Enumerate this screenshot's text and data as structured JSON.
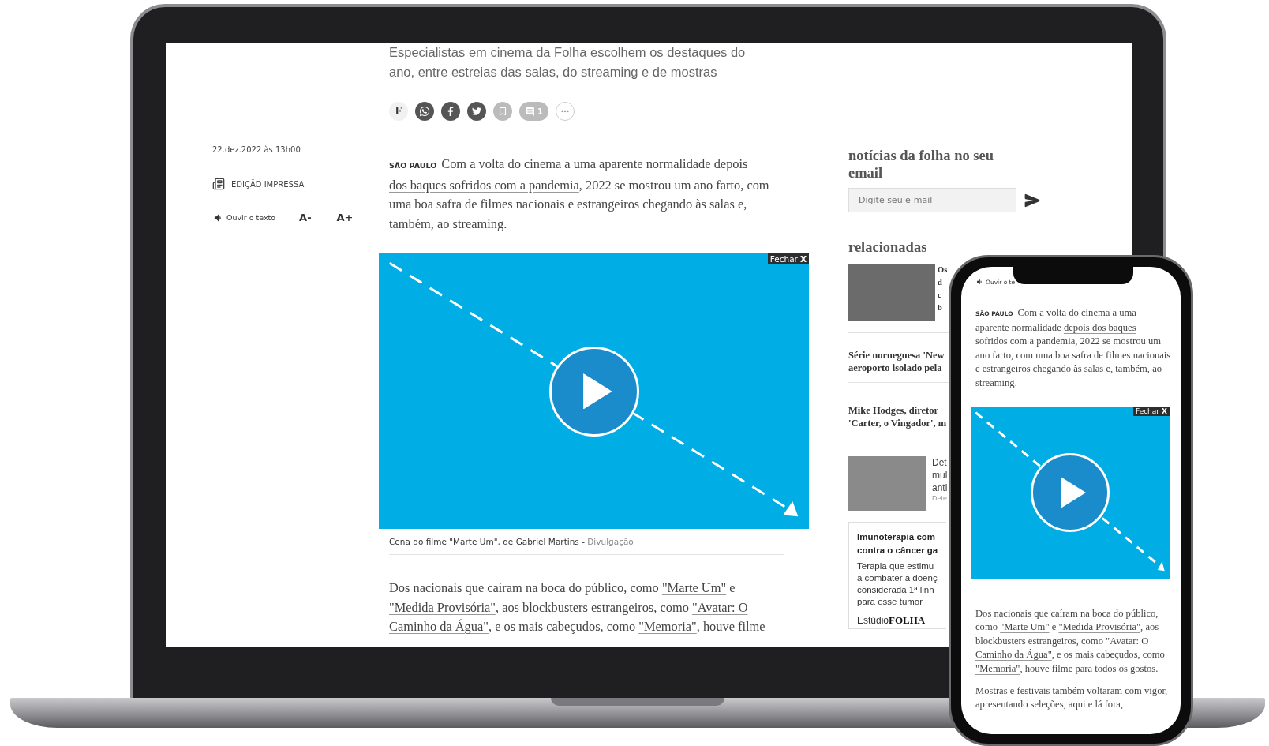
{
  "laptop": {
    "article": {
      "subtitle": "Especialistas em cinema da Folha escolhem os destaques do ano, entre estreias das salas, do streaming e de mostras",
      "share_buttons": [
        {
          "kind": "folha",
          "label": "F"
        },
        {
          "kind": "whatsapp"
        },
        {
          "kind": "facebook"
        },
        {
          "kind": "twitter"
        },
        {
          "kind": "bookmark"
        },
        {
          "kind": "comments",
          "count": "1"
        },
        {
          "kind": "more"
        }
      ],
      "date": "22.dez.2022 às 13h00",
      "print_edition": "EDIÇÃO IMPRESSA",
      "listen": "Ouvir o texto",
      "font_smaller": "A-",
      "font_larger": "A+",
      "lead": {
        "dateline": "SÃO PAULO",
        "segments": [
          {
            "kind": "text",
            "text": "Com a volta do cinema a uma aparente normalidade "
          },
          {
            "kind": "link",
            "text": "depois"
          },
          {
            "kind": "link",
            "text": "dos baques sofridos com a pandemia"
          },
          {
            "kind": "text",
            "text": ", 2022 se mostrou um ano farto, com uma boa safra de filmes nacionais e estrangeiros chegando às salas e, também, ao streaming."
          }
        ]
      },
      "video": {
        "close_label": "Fechar",
        "close_glyph": "X"
      },
      "caption": {
        "text": "Cena do filme \"Marte Um\", de Gabriel Martins -",
        "credit": "Divulgação"
      },
      "paragraphs": [
        {
          "segments": [
            {
              "kind": "text",
              "text": "Dos nacionais que caíram na boca do público, como "
            },
            {
              "kind": "link",
              "text": "\"Marte Um\""
            },
            {
              "kind": "text",
              "text": " e "
            },
            {
              "kind": "link",
              "text": "\"Medida Provisória\""
            },
            {
              "kind": "text",
              "text": ", aos blockbusters estrangeiros, como "
            },
            {
              "kind": "link",
              "text": "\"Avatar: O"
            },
            {
              "kind": "link",
              "text": "Caminho da Água\""
            },
            {
              "kind": "text",
              "text": ", e os mais cabeçudos, como "
            },
            {
              "kind": "link",
              "text": "\"Memoria\""
            },
            {
              "kind": "text",
              "text": ", houve filme"
            }
          ]
        }
      ]
    },
    "sidebar": {
      "newsletter": {
        "title": "notícias da folha no seu email",
        "placeholder": "Digite seu e-mail"
      },
      "related": {
        "title": "relacionadas",
        "items": [
          {
            "kind": "photo",
            "lines": [
              "Os",
              "d",
              "c",
              "b"
            ]
          },
          {
            "kind": "headline",
            "lines": [
              "Série norueguesa 'New",
              "aeroporto isolado pela"
            ]
          },
          {
            "kind": "headline",
            "lines": [
              "Mike Hodges, diretor",
              "'Carter, o Vingador', m"
            ]
          },
          {
            "kind": "photo_small",
            "lines": [
              "Det",
              "mul",
              "anti"
            ],
            "source": "Dete"
          }
        ]
      },
      "ad": {
        "title_lines": [
          "Imunoterapia com",
          "contra o câncer ga"
        ],
        "body_lines": [
          "Terapia que estimu",
          "a combater a doenç",
          "considerada 1ª linh",
          "para esse tumor"
        ],
        "sponsor": "Estúdio",
        "brand": "FOLHA"
      }
    }
  },
  "phone": {
    "listen": "Ouvir o te",
    "lead": {
      "dateline": "SÃO PAULO",
      "segments": [
        {
          "kind": "text",
          "text": "Com a volta do cinema a uma aparente normalidade "
        },
        {
          "kind": "link",
          "text": "depois dos baques"
        },
        {
          "kind": "link",
          "text": "sofridos com a pandemia"
        },
        {
          "kind": "text",
          "text": ", 2022 se mostrou um ano farto, com uma boa safra de filmes nacionais e estrangeiros chegando às salas e, também, ao streaming."
        }
      ]
    },
    "video": {
      "close_label": "Fechar",
      "close_glyph": "X"
    },
    "paragraphs": [
      {
        "segments": [
          {
            "kind": "text",
            "text": "Dos nacionais que caíram na boca do público, como "
          },
          {
            "kind": "link",
            "text": "\"Marte Um\""
          },
          {
            "kind": "text",
            "text": " e "
          },
          {
            "kind": "link",
            "text": "\"Medida Provisória\""
          },
          {
            "kind": "text",
            "text": ", aos blockbusters estrangeiros, como "
          },
          {
            "kind": "link",
            "text": "\"Avatar: O"
          },
          {
            "kind": "link",
            "text": "Caminho da Água\""
          },
          {
            "kind": "text",
            "text": ", e os mais cabeçudos, como "
          },
          {
            "kind": "link",
            "text": "\"Memoria\""
          },
          {
            "kind": "text",
            "text": ", houve filme para todos os gostos."
          }
        ]
      },
      {
        "segments": [
          {
            "kind": "text",
            "text": "Mostras e festivais também voltaram com vigor, apresentando seleções, aqui e lá fora,"
          }
        ]
      }
    ]
  }
}
